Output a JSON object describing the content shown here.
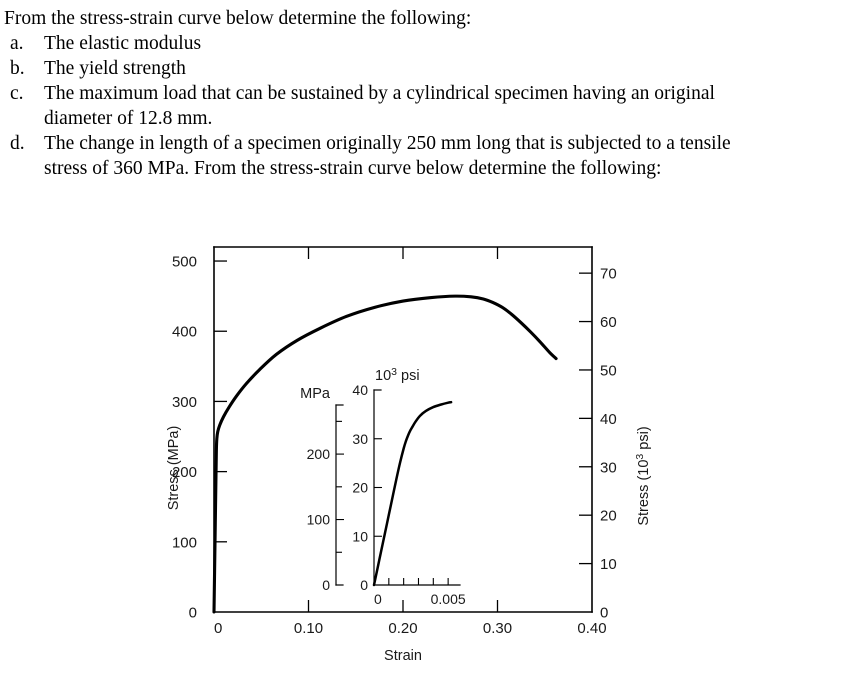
{
  "question": {
    "intro": "From the stress-strain curve below determine the following:",
    "items": [
      {
        "marker": "a.",
        "text": "The elastic modulus",
        "text_cont": ""
      },
      {
        "marker": "b.",
        "text": "The yield strength",
        "text_cont": ""
      },
      {
        "marker": "c.",
        "text": "The maximum load that can be sustained by a cylindrical specimen having an original",
        "text_cont": "diameter of 12.8 mm."
      },
      {
        "marker": "d.",
        "text": "The change in length of a specimen originally 250 mm long that is subjected to a tensile",
        "text_cont": "stress of 360 MPa. From the stress-strain curve below determine the following:"
      }
    ]
  },
  "chart_data": {
    "type": "line",
    "title": "",
    "main": {
      "xlabel": "Strain",
      "ylabel_left": "Stress (MPa)",
      "ylabel_right_prefix": "Stress (10",
      "ylabel_right_sup": "3",
      "ylabel_right_suffix": " psi)",
      "xlim": [
        0,
        0.4
      ],
      "ylim_left": [
        0,
        520
      ],
      "ylim_right": [
        0,
        75.4
      ],
      "xticks": [
        0,
        0.1,
        0.2,
        0.3,
        0.4
      ],
      "xtick_labels": [
        "0",
        "0.10",
        "0.20",
        "0.30",
        "0.40"
      ],
      "yticks_left": [
        0,
        100,
        200,
        300,
        400,
        500
      ],
      "ytick_labels_left": [
        "0",
        "100",
        "200",
        "300",
        "400",
        "500"
      ],
      "yticks_right": [
        0,
        10,
        20,
        30,
        40,
        50,
        60,
        70
      ],
      "ytick_labels_right": [
        "0",
        "10",
        "20",
        "30",
        "40",
        "50",
        "60",
        "70"
      ],
      "grid": false,
      "legend": "none",
      "series": [
        {
          "name": "stress-strain curve",
          "x": [
            0.0,
            0.001,
            0.002,
            0.0025,
            0.003,
            0.004,
            0.006,
            0.01,
            0.016,
            0.024,
            0.034,
            0.048,
            0.066,
            0.088,
            0.112,
            0.14,
            0.17,
            0.2,
            0.23,
            0.255,
            0.272,
            0.285,
            0.295,
            0.305,
            0.315,
            0.325,
            0.335,
            0.345,
            0.355,
            0.362
          ],
          "y": [
            0,
            93,
            186,
            230,
            247,
            257,
            266,
            278,
            292,
            308,
            325,
            345,
            367,
            387,
            404,
            421,
            434,
            443,
            448,
            450,
            449,
            446,
            441,
            434,
            424,
            412,
            399,
            385,
            370,
            361
          ]
        }
      ]
    },
    "inset": {
      "xlabel": "",
      "unit_left": "MPa",
      "unit_right_prefix": "10",
      "unit_right_sup": "3",
      "unit_right_suffix": " psi",
      "xlim": [
        0,
        0.0058
      ],
      "ylim_mpa": [
        0,
        275
      ],
      "ylim_psi": [
        0,
        40
      ],
      "xticks": [
        0,
        0.005
      ],
      "xtick_labels": [
        "0",
        "0.005"
      ],
      "xtick_minor": [
        0.001,
        0.002,
        0.003,
        0.004,
        0.005
      ],
      "yticks_mpa": [
        0,
        100,
        200
      ],
      "ytick_labels_mpa": [
        "0",
        "100",
        "200"
      ],
      "ytick_minor_mpa": [
        50,
        150,
        250
      ],
      "yticks_psi": [
        0,
        10,
        20,
        30,
        40
      ],
      "ytick_labels_psi": [
        "0",
        "10",
        "20",
        "30",
        "40"
      ],
      "series": [
        {
          "name": "elastic region detail",
          "x": [
            0.0,
            0.00025,
            0.0005,
            0.00075,
            0.001,
            0.00125,
            0.0015,
            0.00175,
            0.002,
            0.00215,
            0.0023,
            0.00245,
            0.0026,
            0.0028,
            0.0031,
            0.0035,
            0.004,
            0.0045,
            0.005,
            0.0052
          ],
          "y_psi": [
            0,
            3.6,
            7.2,
            10.8,
            14.4,
            18.0,
            21.6,
            25.0,
            28.0,
            29.5,
            30.7,
            31.7,
            32.5,
            33.5,
            34.7,
            35.7,
            36.5,
            37.0,
            37.4,
            37.5
          ]
        }
      ]
    }
  }
}
